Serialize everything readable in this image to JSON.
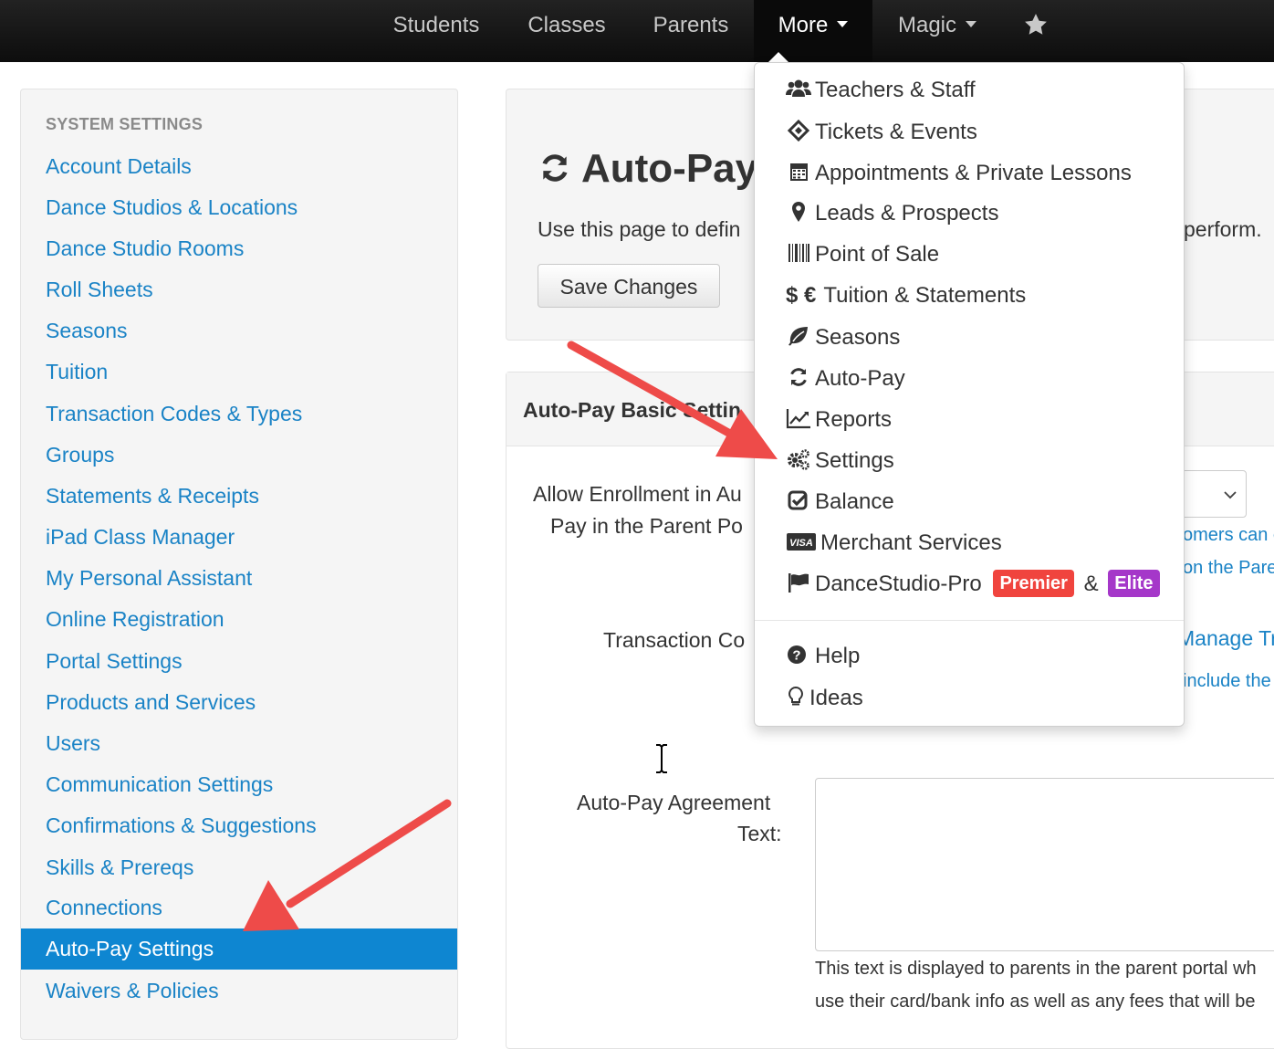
{
  "navbar": {
    "items": [
      {
        "label": "Students"
      },
      {
        "label": "Classes"
      },
      {
        "label": "Parents"
      },
      {
        "label": "More"
      },
      {
        "label": "Magic"
      }
    ],
    "star_icon": "star-icon"
  },
  "sidebar": {
    "header": "SYSTEM SETTINGS",
    "items": [
      {
        "label": "Account Details"
      },
      {
        "label": "Dance Studios & Locations"
      },
      {
        "label": "Dance Studio Rooms"
      },
      {
        "label": "Roll Sheets"
      },
      {
        "label": "Seasons"
      },
      {
        "label": "Tuition"
      },
      {
        "label": "Transaction Codes & Types"
      },
      {
        "label": "Groups"
      },
      {
        "label": "Statements & Receipts"
      },
      {
        "label": "iPad Class Manager"
      },
      {
        "label": "My Personal Assistant"
      },
      {
        "label": "Online Registration"
      },
      {
        "label": "Portal Settings"
      },
      {
        "label": "Products and Services"
      },
      {
        "label": "Users"
      },
      {
        "label": "Communication Settings"
      },
      {
        "label": "Confirmations & Suggestions"
      },
      {
        "label": "Skills & Prereqs"
      },
      {
        "label": "Connections"
      },
      {
        "label": "Auto-Pay Settings"
      },
      {
        "label": "Waivers & Policies"
      }
    ],
    "active_index": 19
  },
  "main": {
    "title": "Auto-Pay",
    "description": "Use this page to defin",
    "description_tail": "perform.",
    "save_label": "Save Changes",
    "basic_section_title": "Auto-Pay Basic Settin",
    "allow_label_line1": "Allow Enrollment in Au",
    "allow_label_line2": "Pay in the Parent Po",
    "allow_help_line1": "omers can c",
    "allow_help_line2": "on the Pare",
    "transaction_label": "Transaction Co",
    "transaction_help_line1": "Manage Tr",
    "transaction_help_line2": "include the",
    "agreement_label_line1": "Auto-Pay Agreement",
    "agreement_label_line2": "Text:",
    "agreement_note_line1": "This text is displayed to parents in the parent portal wh",
    "agreement_note_line2": "use their card/bank info as well as any fees that will be"
  },
  "dropdown": {
    "items": [
      {
        "label": "Teachers & Staff",
        "icon": "users-icon"
      },
      {
        "label": "Tickets & Events",
        "icon": "ticket-icon"
      },
      {
        "label": "Appointments & Private Lessons",
        "icon": "calendar-icon"
      },
      {
        "label": "Leads & Prospects",
        "icon": "map-marker-icon"
      },
      {
        "label": "Point of Sale",
        "icon": "barcode-icon"
      },
      {
        "label": "Tuition & Statements",
        "icon": "currency-icon",
        "prefix": "$ €"
      },
      {
        "label": "Seasons",
        "icon": "leaf-icon"
      },
      {
        "label": "Auto-Pay",
        "icon": "refresh-icon"
      },
      {
        "label": "Reports",
        "icon": "line-chart-icon"
      },
      {
        "label": "Settings",
        "icon": "cogs-icon"
      },
      {
        "label": "Balance",
        "icon": "check-square-icon"
      },
      {
        "label": "Merchant Services",
        "icon": "visa-icon"
      },
      {
        "label": "DanceStudio-Pro",
        "icon": "flag-icon"
      }
    ],
    "premier_badge": "Premier",
    "amp": "&",
    "elite_badge": "Elite",
    "help_label": "Help",
    "ideas_label": "Ideas",
    "colors": {
      "premier": "#f0443e",
      "elite": "#a537c9",
      "active_nav": "#0e86d1",
      "arrow": "#ee4b49"
    }
  }
}
